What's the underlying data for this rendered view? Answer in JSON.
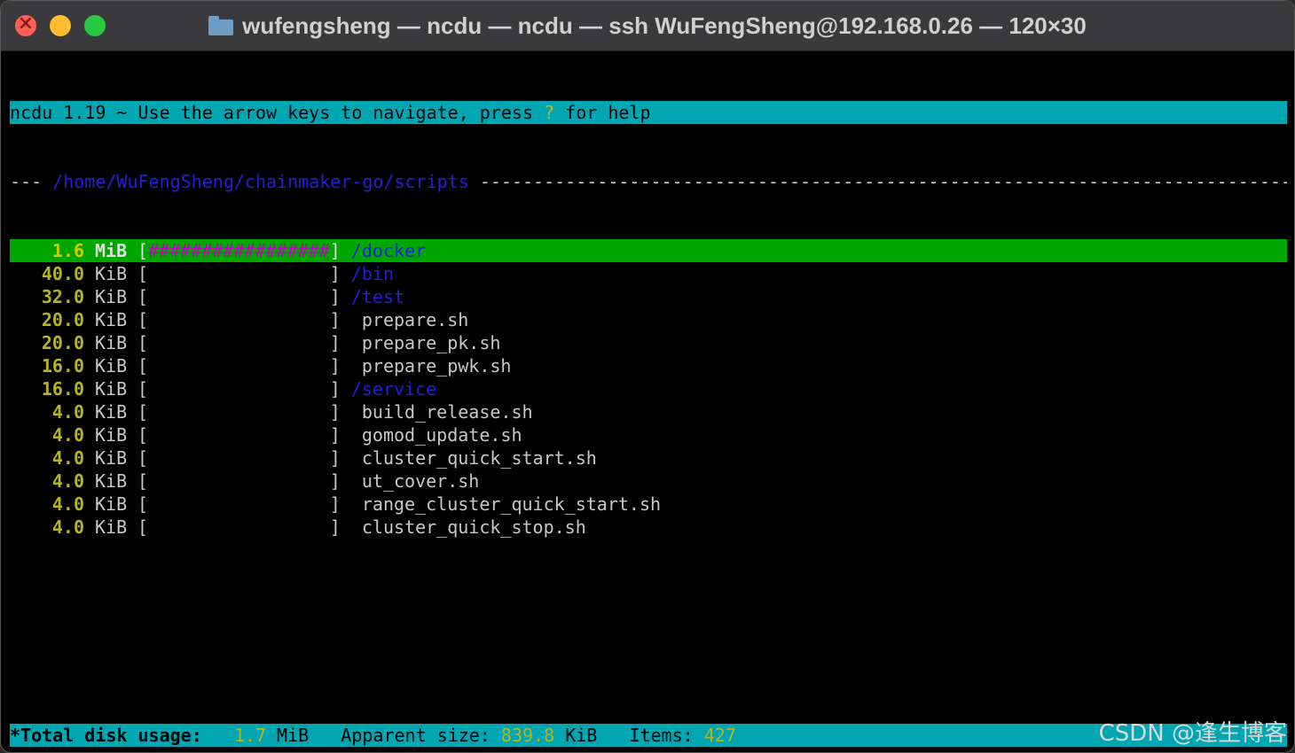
{
  "window": {
    "title": "wufengsheng — ncdu — ncdu — ssh WuFengSheng@192.168.0.26 — 120×30"
  },
  "header": {
    "prefix": "ncdu 1.19 ~ Use the arrow keys to navigate, press ",
    "key": "?",
    "suffix": " for help"
  },
  "path": {
    "lead": "--- ",
    "dir": "/home/WuFengSheng/chainmaker-go/scripts",
    "trail": " -------------------------------------------------------------------------------------------"
  },
  "entries": [
    {
      "size": "1.6",
      "unit": "MiB",
      "graph": "#################",
      "name": "/docker",
      "is_dir": true,
      "selected": true
    },
    {
      "size": "40.0",
      "unit": "KiB",
      "graph": "                 ",
      "name": "/bin",
      "is_dir": true
    },
    {
      "size": "32.0",
      "unit": "KiB",
      "graph": "                 ",
      "name": "/test",
      "is_dir": true
    },
    {
      "size": "20.0",
      "unit": "KiB",
      "graph": "                 ",
      "name": "prepare.sh",
      "is_dir": false
    },
    {
      "size": "20.0",
      "unit": "KiB",
      "graph": "                 ",
      "name": "prepare_pk.sh",
      "is_dir": false
    },
    {
      "size": "16.0",
      "unit": "KiB",
      "graph": "                 ",
      "name": "prepare_pwk.sh",
      "is_dir": false
    },
    {
      "size": "16.0",
      "unit": "KiB",
      "graph": "                 ",
      "name": "/service",
      "is_dir": true
    },
    {
      "size": "4.0",
      "unit": "KiB",
      "graph": "                 ",
      "name": "build_release.sh",
      "is_dir": false
    },
    {
      "size": "4.0",
      "unit": "KiB",
      "graph": "                 ",
      "name": "gomod_update.sh",
      "is_dir": false
    },
    {
      "size": "4.0",
      "unit": "KiB",
      "graph": "                 ",
      "name": "cluster_quick_start.sh",
      "is_dir": false
    },
    {
      "size": "4.0",
      "unit": "KiB",
      "graph": "                 ",
      "name": "ut_cover.sh",
      "is_dir": false
    },
    {
      "size": "4.0",
      "unit": "KiB",
      "graph": "                 ",
      "name": "range_cluster_quick_start.sh",
      "is_dir": false
    },
    {
      "size": "4.0",
      "unit": "KiB",
      "graph": "                 ",
      "name": "cluster_quick_stop.sh",
      "is_dir": false
    }
  ],
  "footer": {
    "total_label": "*Total disk usage:",
    "total_value": "1.7",
    "total_unit": "MiB",
    "apparent_label": "Apparent size:",
    "apparent_value": "839.8",
    "apparent_unit": "KiB",
    "items_label": "Items:",
    "items_value": "427"
  },
  "watermark": "CSDN @逢生博客",
  "colors": {
    "header_bar": "#00a6b2",
    "selected_row": "#00a600",
    "size_yellow": "#b5b520",
    "dir_blue": "#2020d8",
    "graph_magenta": "#c000c0"
  }
}
